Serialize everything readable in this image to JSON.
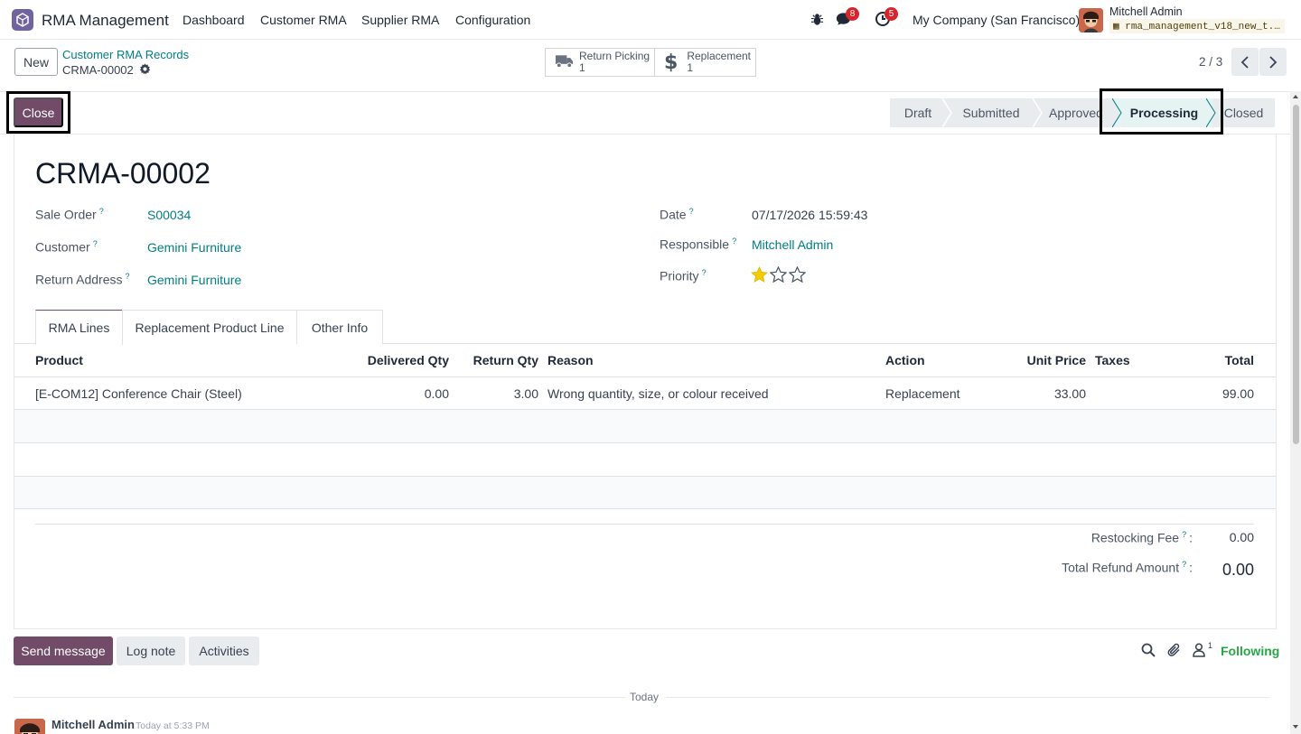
{
  "navbar": {
    "app_name": "RMA Management",
    "menu": [
      "Dashboard",
      "Customer RMA",
      "Supplier RMA",
      "Configuration"
    ],
    "messages_count": "8",
    "activities_count": "5",
    "company": "My Company (San Francisco)",
    "user_name": "Mitchell Admin",
    "database": "rma_management_v18_new_t..."
  },
  "control": {
    "new_label": "New",
    "breadcrumb": "Customer RMA Records",
    "record": "CRMA-00002",
    "smart_buttons": [
      {
        "label": "Return Picking",
        "count": "1"
      },
      {
        "label": "Replacement",
        "count": "1"
      }
    ],
    "pager": "2 / 3"
  },
  "statusbar": {
    "close_label": "Close",
    "stages": [
      "Draft",
      "Submitted",
      "Approved",
      "Processing",
      "Closed"
    ],
    "active_stage": "Processing"
  },
  "form": {
    "title": "CRMA-00002",
    "left": [
      {
        "label": "Sale Order",
        "value": "S00034"
      },
      {
        "label": "Customer",
        "value": "Gemini Furniture"
      },
      {
        "label": "Return Address",
        "value": "Gemini Furniture"
      }
    ],
    "right": [
      {
        "label": "Date",
        "value": "07/17/2026 15:59:43"
      },
      {
        "label": "Responsible",
        "value": "Mitchell Admin"
      },
      {
        "label": "Priority",
        "value": ""
      }
    ],
    "priority_stars": 1,
    "help_mark": "?"
  },
  "tabs": [
    "RMA Lines",
    "Replacement Product Line",
    "Other Info"
  ],
  "table": {
    "headers": [
      "Product",
      "Delivered Qty",
      "Return Qty",
      "Reason",
      "Action",
      "Unit Price",
      "Taxes",
      "Total"
    ],
    "rows": [
      [
        "[E-COM12] Conference Chair (Steel)",
        "0.00",
        "3.00",
        "Wrong quantity, size, or colour received",
        "Replacement",
        "33.00",
        "",
        "99.00"
      ]
    ]
  },
  "totals": {
    "restocking_label": "Restocking Fee",
    "restocking_value": "0.00",
    "refund_label": "Total Refund Amount",
    "refund_value": "0.00",
    "colon": ":"
  },
  "chatter": {
    "send_message": "Send message",
    "log_note": "Log note",
    "activities": "Activities",
    "followers_count": "1",
    "following": "Following",
    "today": "Today",
    "author": "Mitchell Admin",
    "time": "Today at 5:33 PM"
  },
  "colors": {
    "brand": "#714b67",
    "link": "#017e84",
    "badge": "#d9242b",
    "following": "#28a745"
  }
}
